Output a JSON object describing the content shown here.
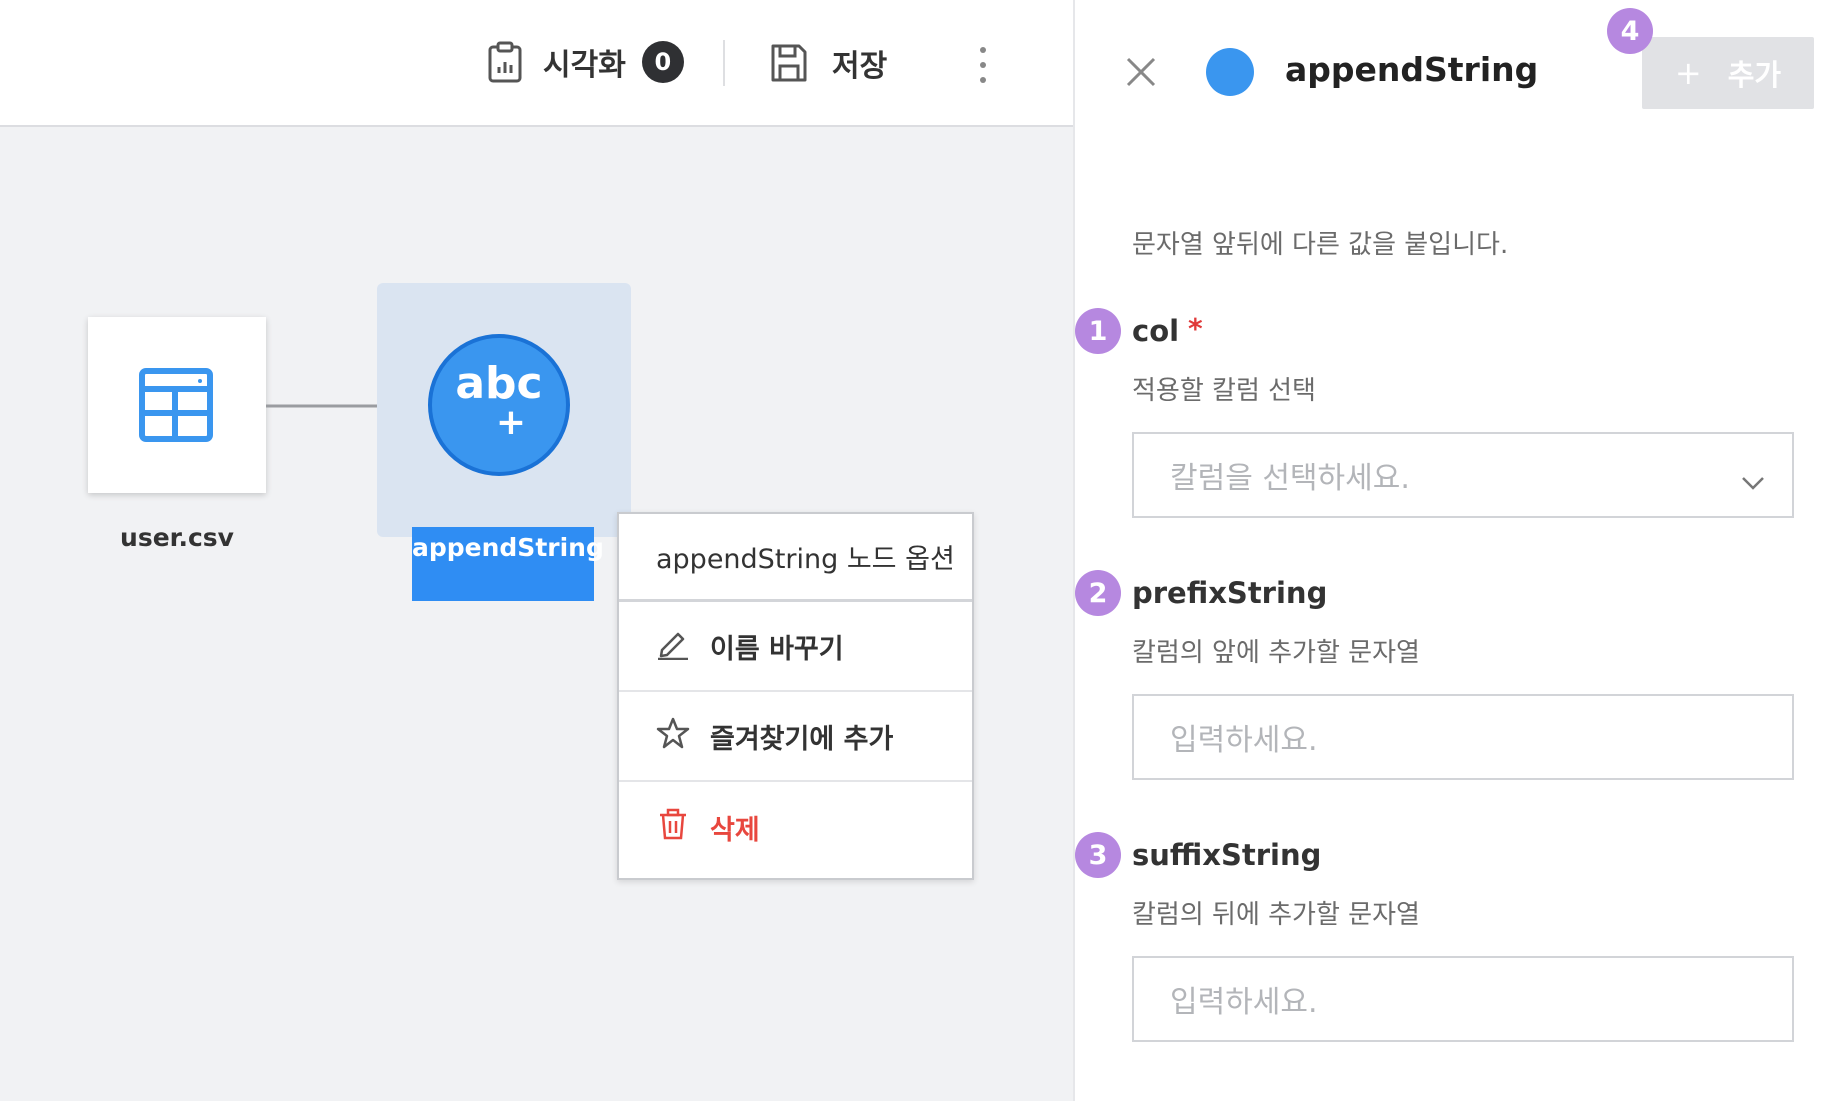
{
  "toolbar": {
    "visualize_label": "시각화",
    "visualize_count": "0",
    "save_label": "저장"
  },
  "canvas": {
    "source_node": {
      "label": "user.csv"
    },
    "append_node": {
      "label": "appendString",
      "glyph": "abc",
      "plus": "+"
    }
  },
  "context_menu": {
    "header": "appendString 노드 옵션",
    "items": [
      {
        "label": "이름 바꾸기",
        "icon": "pencil-icon"
      },
      {
        "label": "즐겨찾기에 추가",
        "icon": "star-icon"
      },
      {
        "label": "삭제",
        "icon": "trash-icon",
        "color": "#e8473e"
      }
    ]
  },
  "panel": {
    "title": "appendString",
    "node_color": "#3a96ef",
    "add_button_label": "추가",
    "add_button_plus": "+",
    "description": "문자열 앞뒤에 다른 값을 붙입니다.",
    "fields": [
      {
        "step": "1",
        "name": "col",
        "required": "*",
        "help": "적용할 칼럼 선택",
        "placeholder": "칼럼을 선택하세요."
      },
      {
        "step": "2",
        "name": "prefixString",
        "help": "칼럼의 앞에 추가할 문자열",
        "placeholder": "입력하세요."
      },
      {
        "step": "3",
        "name": "suffixString",
        "help": "칼럼의 뒤에 추가할 문자열",
        "placeholder": "입력하세요."
      }
    ],
    "add_step": "4"
  },
  "colors": {
    "accent_blue": "#3a96ef",
    "step_purple": "#b688e0",
    "danger_red": "#e8473e",
    "required_red": "#e03a3a"
  }
}
